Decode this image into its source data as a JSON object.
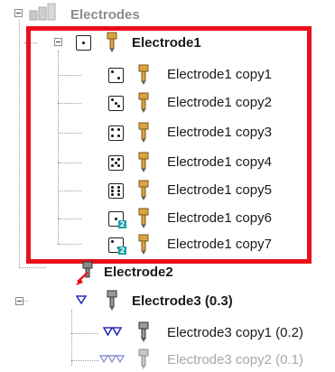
{
  "tree": {
    "root": {
      "label": "Electrodes"
    },
    "electrode1": {
      "label": "Electrode1",
      "copies": [
        {
          "label": "Electrode1 copy1"
        },
        {
          "label": "Electrode1 copy2"
        },
        {
          "label": "Electrode1 copy3"
        },
        {
          "label": "Electrode1 copy4"
        },
        {
          "label": "Electrode1 copy5"
        },
        {
          "label": "Electrode1 copy6",
          "badge": "2"
        },
        {
          "label": "Electrode1 copy7",
          "badge": "2"
        }
      ]
    },
    "electrode2": {
      "label": "Electrode2"
    },
    "electrode3": {
      "label": "Electrode3 (0.3)",
      "copies": [
        {
          "label": "Electrode3 copy1 (0.2)"
        },
        {
          "label": "Electrode3 copy2 (0.1)"
        }
      ]
    }
  },
  "colors": {
    "highlight": "#e8101a",
    "pin_gold": "#d9a441",
    "badge": "#1aa0a8",
    "triangle_blue": "#2a2fb8"
  }
}
